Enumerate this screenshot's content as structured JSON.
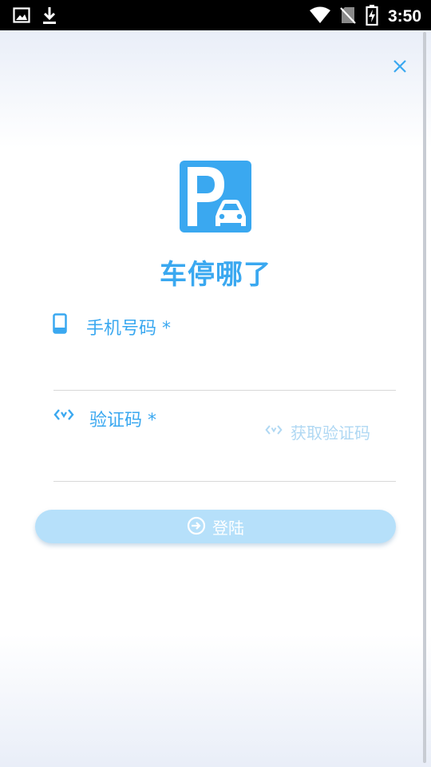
{
  "status_bar": {
    "time": "3:50",
    "icons": [
      "image-icon",
      "download-icon",
      "wifi-icon",
      "no-sim-icon",
      "battery-charging-icon"
    ]
  },
  "app": {
    "title": "车停哪了",
    "logo": "parking-car-logo"
  },
  "close": {
    "icon": "close-icon"
  },
  "phone_field": {
    "label": "手机号码 *",
    "icon": "phone-icon",
    "value": ""
  },
  "code_field": {
    "label": "验证码 *",
    "icon": "code-icon",
    "value": ""
  },
  "get_code": {
    "label": "获取验证码",
    "icon": "code-icon"
  },
  "login": {
    "label": "登陆",
    "icon": "login-arrow-icon"
  },
  "colors": {
    "accent": "#3aa8f0",
    "button_disabled": "#b6e0fa",
    "hint_disabled": "#b0d8f3"
  }
}
